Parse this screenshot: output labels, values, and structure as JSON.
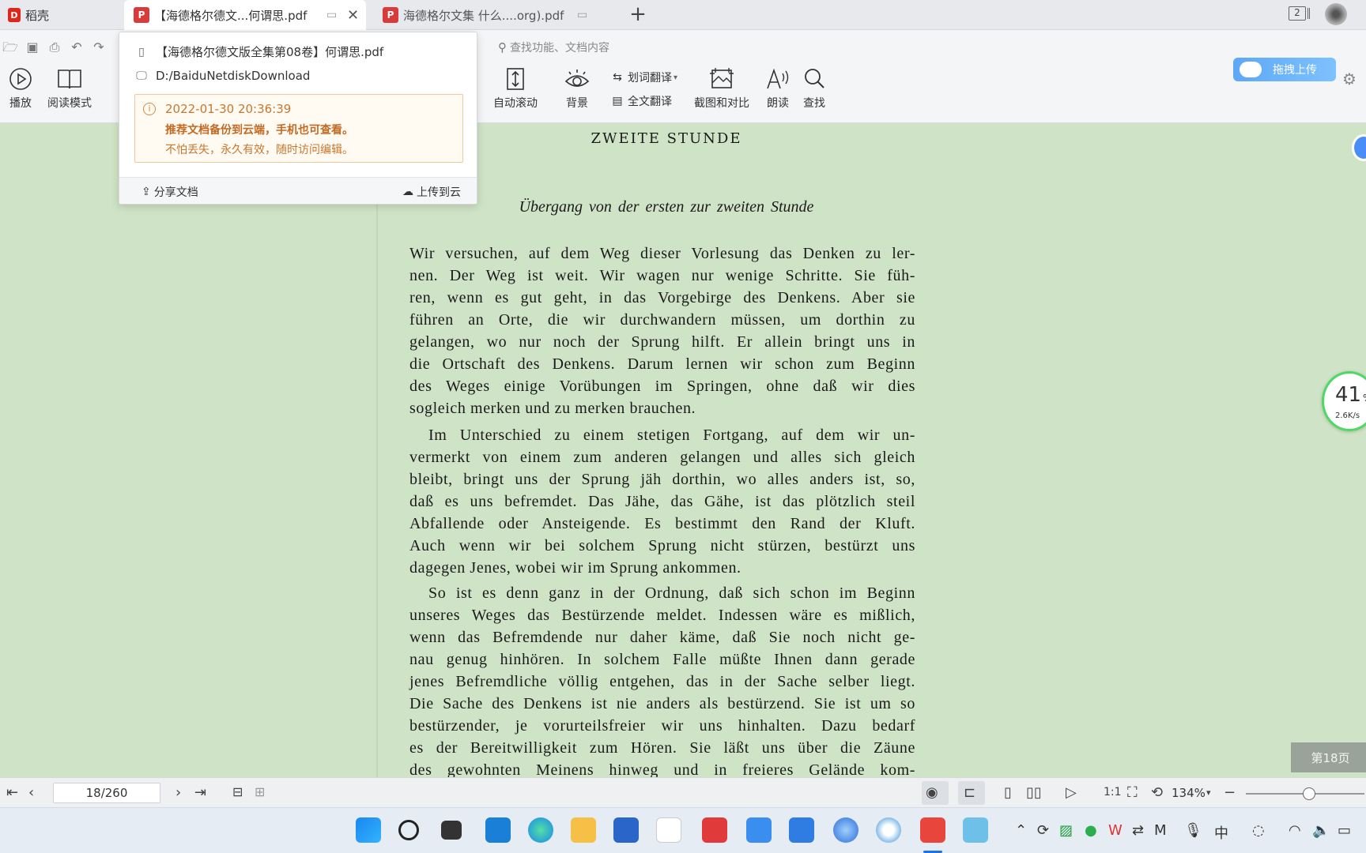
{
  "tabs": {
    "home_label": "稻壳",
    "home_logo": "D",
    "pdf_icon": "P",
    "tab1_label": "【海德格尔德文...何谓思.pdf",
    "tab2_label": "海德格尔文集 什么....org).pdf",
    "new_tab": "+",
    "tab_count": "2"
  },
  "toolbar": {
    "search_placeholder": "查找功能、文档内容",
    "play": "播放",
    "read_mode": "阅读模式",
    "auto_scroll": "自动滚动",
    "background": "背景",
    "word_translate": "划词翻译",
    "full_translate": "全文翻译",
    "screenshot_compare": "截图和对比",
    "read_aloud": "朗读",
    "find": "查找",
    "baidu_upload": "拖拽上传"
  },
  "popup": {
    "file_name": "【海德格尔德文版全集第08卷】何谓思.pdf",
    "path": "D:/BaiduNetdiskDownload",
    "time": "2022-01-30 20:36:39",
    "recommend": "推荐文档备份到云端，手机也可查看。",
    "sub": "不怕丢失，永久有效，随时访问编辑。",
    "share": "分享文档",
    "upload": "上传到云"
  },
  "document": {
    "chapter": "ZWEITE STUNDE",
    "subtitle": "Übergang von der ersten zur zweiten Stunde",
    "p1": [
      "Wir versuchen, auf dem Weg dieser Vorlesung das Denken zu ler-",
      "nen. Der Weg ist weit. Wir wagen nur wenige Schritte. Sie füh-",
      "ren, wenn es gut geht, in das Vorgebirge des Denkens. Aber sie",
      "führen an Orte, die wir durchwandern müssen, um dorthin zu",
      "gelangen, wo nur noch der Sprung hilft. Er allein bringt uns in",
      "die Ortschaft des Denkens. Darum lernen wir schon zum Beginn",
      "des Weges einige Vorübungen im Springen, ohne daß wir dies",
      "sogleich merken und zu merken brauchen."
    ],
    "p2": [
      "Im Unterschied zu einem stetigen Fortgang, auf dem wir un-",
      "vermerkt von einem zum anderen gelangen und alles sich gleich",
      "bleibt, bringt uns der Sprung jäh dorthin, wo alles anders ist, so,",
      "daß es uns befremdet. Das Jähe, das Gähe, ist das plötzlich steil",
      "Abfallende oder Ansteigende. Es bestimmt den Rand der Kluft.",
      "Auch wenn wir bei solchem Sprung nicht stürzen, bestürzt uns",
      "dagegen Jenes, wobei wir im Sprung ankommen."
    ],
    "p3": [
      "So ist es denn ganz in der Ordnung, daß sich schon im Beginn",
      "unseres Weges das Bestürzende meldet. Indessen wäre es mißlich,",
      "wenn das Befremdende nur daher käme, daß Sie noch nicht ge-",
      "nau genug hinhören. In solchem Falle müßte Ihnen dann gerade",
      "jenes Befremdliche völlig entgehen, das in der Sache selber liegt.",
      "Die Sache des Denkens ist nie anders als bestürzend. Sie ist um so",
      "bestürzender, je vorurteilsfreier wir uns hinhalten. Dazu bedarf",
      "es der Bereitwilligkeit zum Hören. Sie läßt uns über die Zäune",
      "des gewohnten Meinens hinweg und in freieres Gelände kom-"
    ]
  },
  "side": {
    "speed_value": "41",
    "speed_unit": "%",
    "speed_rate": "2.6K/s",
    "page_badge": "第18页"
  },
  "status": {
    "page_field": "18/260",
    "zoom": "134%",
    "zoom_fraction": 0.53
  },
  "colors": {
    "page_bg": "#cfe3c6",
    "accent_orange": "#c8772f",
    "speed_ring": "#4cd964"
  }
}
